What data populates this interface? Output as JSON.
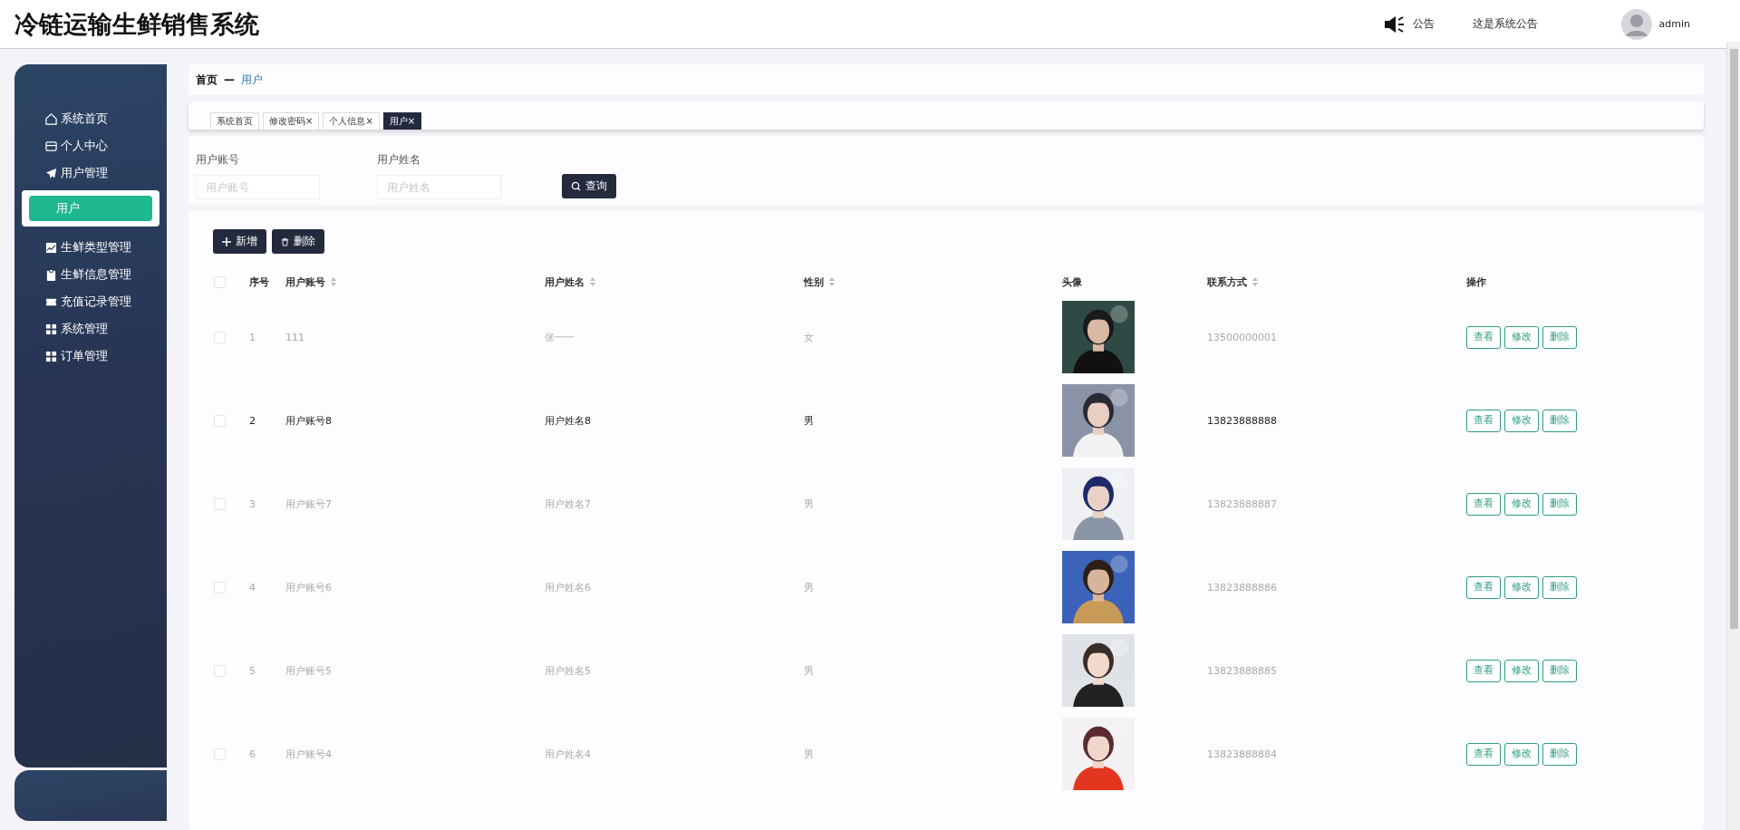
{
  "header": {
    "title": "冷链运输生鲜销售系统",
    "notice_label": "公告",
    "notice_text": "这是系统公告",
    "user": "admin"
  },
  "sidebar": {
    "items": [
      {
        "label": "系统首页",
        "kind": "home"
      },
      {
        "label": "个人中心",
        "kind": "card"
      },
      {
        "label": "用户管理",
        "kind": "plane",
        "children": [
          {
            "label": "用户",
            "selected": true
          }
        ]
      },
      {
        "label": "生鲜类型管理",
        "kind": "chart"
      },
      {
        "label": "生鲜信息管理",
        "kind": "clipboard"
      },
      {
        "label": "充值记录管理",
        "kind": "ticket"
      },
      {
        "label": "系统管理",
        "kind": "grid"
      },
      {
        "label": "订单管理",
        "kind": "grid"
      }
    ]
  },
  "breadcrumb": {
    "home": "首页",
    "separator": "—",
    "current": "用户"
  },
  "tabs": [
    {
      "label": "系统首页",
      "selected": false
    },
    {
      "label": "修改密码",
      "close": "×",
      "selected": false
    },
    {
      "label": "个人信息",
      "close": "×",
      "selected": false
    },
    {
      "label": "用户",
      "close": "×",
      "selected": true
    }
  ],
  "search": {
    "fields": [
      {
        "label": "用户账号",
        "placeholder": "用户账号"
      },
      {
        "label": "用户姓名",
        "placeholder": "用户姓名"
      }
    ],
    "button": "查询"
  },
  "actions": [
    {
      "label": "新增",
      "kind": "add"
    },
    {
      "label": "删除",
      "kind": "delete"
    }
  ],
  "table": {
    "all_checked": false,
    "columns": [
      {
        "label": "序号"
      },
      {
        "label": "用户账号",
        "sortable": true
      },
      {
        "label": "用户姓名",
        "sortable": true
      },
      {
        "label": "性别",
        "sortable": true
      },
      {
        "label": "头像"
      },
      {
        "label": "联系方式",
        "sortable": true
      },
      {
        "label": "操作"
      }
    ],
    "rows": [
      {
        "index": "1",
        "account": "111",
        "name": "张一一",
        "gender": "女",
        "phone": "13500000001",
        "checked": false,
        "highlighted": false,
        "avatar": {
          "kind": "picture"
        },
        "buttons": [
          "查看",
          "修改",
          "删除"
        ]
      },
      {
        "index": "2",
        "account": "用户账号8",
        "name": "用户姓名8",
        "gender": "男",
        "phone": "13823888888",
        "checked": false,
        "highlighted": true,
        "avatar": {
          "kind": "picture"
        },
        "buttons": [
          "查看",
          "修改",
          "删除"
        ]
      },
      {
        "index": "3",
        "account": "用户账号7",
        "name": "用户姓名7",
        "gender": "男",
        "phone": "13823888887",
        "checked": false,
        "highlighted": false,
        "avatar": {
          "kind": "picture"
        },
        "buttons": [
          "查看",
          "修改",
          "删除"
        ]
      },
      {
        "index": "4",
        "account": "用户账号6",
        "name": "用户姓名6",
        "gender": "男",
        "phone": "13823888886",
        "checked": false,
        "highlighted": false,
        "avatar": {
          "kind": "picture"
        },
        "buttons": [
          "查看",
          "修改",
          "删除"
        ]
      },
      {
        "index": "5",
        "account": "用户账号5",
        "name": "用户姓名5",
        "gender": "男",
        "phone": "13823888885",
        "checked": false,
        "highlighted": false,
        "avatar": {
          "kind": "picture"
        },
        "buttons": [
          "查看",
          "修改",
          "删除"
        ]
      },
      {
        "index": "6",
        "account": "用户账号4",
        "name": "用户姓名4",
        "gender": "男",
        "phone": "13823888884",
        "checked": false,
        "highlighted": false,
        "avatar": {
          "kind": "picture"
        },
        "buttons": [
          "查看",
          "修改",
          "删除"
        ]
      }
    ]
  }
}
